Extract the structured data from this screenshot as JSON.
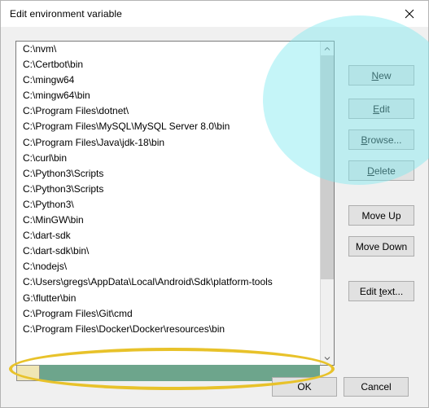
{
  "window": {
    "title": "Edit environment variable",
    "close_icon": "close-icon"
  },
  "list": {
    "items": [
      "C:\\nvm\\",
      "C:\\Certbot\\bin",
      "C:\\mingw64",
      "C:\\mingw64\\bin",
      "C:\\Program Files\\dotnet\\",
      "C:\\Program Files\\MySQL\\MySQL Server 8.0\\bin",
      "C:\\Program Files\\Java\\jdk-18\\bin",
      "C:\\curl\\bin",
      "C:\\Python3\\Scripts",
      "C:\\Python3\\Scripts",
      "C:\\Python3\\",
      "C:\\MinGW\\bin",
      "C:\\dart-sdk",
      "C:\\dart-sdk\\bin\\",
      "C:\\nodejs\\",
      "C:\\Users\\gregs\\AppData\\Local\\Android\\Sdk\\platform-tools",
      "G:\\flutter\\bin",
      "C:\\Program Files\\Git\\cmd",
      "C:\\Program Files\\Docker\\Docker\\resources\\bin",
      ""
    ],
    "editing_row_index": 19,
    "scrollbar": {
      "up_arrow": "chevron-up-icon",
      "down_arrow": "chevron-down-icon"
    }
  },
  "buttons": {
    "new": "New",
    "new_accel": "N",
    "edit": "Edit",
    "edit_accel": "E",
    "browse": "Browse...",
    "browse_accel": "B",
    "delete": "Delete",
    "delete_accel": "D",
    "move_up": "Move Up",
    "move_down": "Move Down",
    "edit_text": "Edit text...",
    "edit_text_accel": "t",
    "ok": "OK",
    "cancel": "Cancel"
  },
  "colors": {
    "highlight_circle": "#7fe9f0",
    "highlight_ellipse": "#e8c22a",
    "edit_cell_fill": "#6da58c",
    "edit_cell_left_fill": "#f0e6b4"
  }
}
